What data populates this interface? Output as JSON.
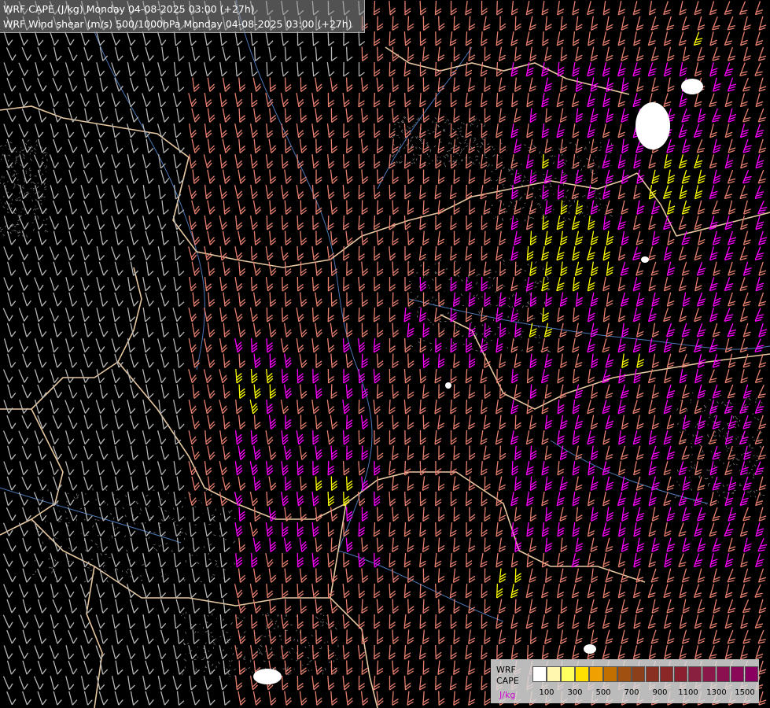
{
  "title": {
    "line1": "WRF CAPE (J/kg) Monday 04-08-2025 03:00 (+27h)",
    "line2": "WRF Wind shear (m/s) 500/1000hPa Monday 04-08-2025 03:00 (+27h)"
  },
  "legend": {
    "line1": "WRF",
    "line2": "CAPE",
    "unit": "J/kg",
    "colors": [
      "#ffffff",
      "#fff7b0",
      "#ffff60",
      "#ffe000",
      "#f0a000",
      "#c07000",
      "#a05010",
      "#8a4018",
      "#8a3020",
      "#8a2828",
      "#8a2030",
      "#8a2040",
      "#8a1848",
      "#8a1050",
      "#8a0858",
      "#8a0060"
    ],
    "ticks": [
      "100",
      "300",
      "500",
      "700",
      "900",
      "1100",
      "1300",
      "1500"
    ]
  },
  "colors": {
    "barb_weak": "#b8b8b8",
    "barb_moderate": "#e88070",
    "barb_strong": "#ff00ff",
    "barb_extreme": "#ffff00",
    "border": "#e8c8a0",
    "river": "#4a78b8",
    "relief": "#7a7a7a"
  }
}
